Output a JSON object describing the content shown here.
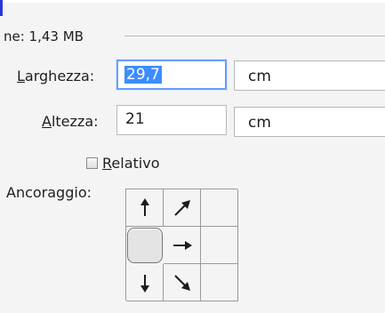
{
  "dialog": {
    "size_label": "ne: 1,43 MB",
    "width_label_prefix": "L",
    "width_label_rest": "arghezza:",
    "width_value": "29,7",
    "width_unit": "cm",
    "height_label_prefix": "A",
    "height_label_rest": "ltezza:",
    "height_value": "21",
    "height_unit": "cm",
    "relative_prefix": "R",
    "relative_rest": "elativo",
    "relative_checked": false,
    "anchor_label": "Ancoraggio:"
  },
  "anchor": {
    "cells": [
      {
        "icon": "arrow-up-icon"
      },
      {
        "icon": "arrow-up-right-icon"
      },
      {
        "icon": "empty"
      },
      {
        "icon": "selected-center"
      },
      {
        "icon": "arrow-right-icon"
      },
      {
        "icon": "empty"
      },
      {
        "icon": "arrow-down-icon"
      },
      {
        "icon": "arrow-down-right-icon"
      },
      {
        "icon": "empty"
      }
    ]
  }
}
